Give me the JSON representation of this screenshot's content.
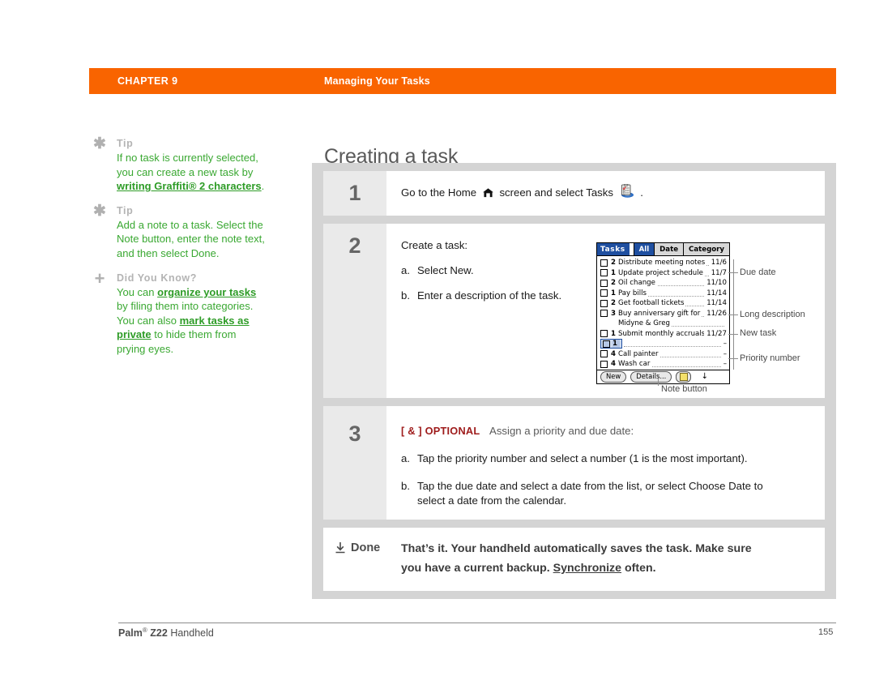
{
  "header": {
    "chapter_label": "CHAPTER 9",
    "chapter_title": "Managing Your Tasks",
    "accent_color": "#f96400"
  },
  "page_title": "Creating a task",
  "sidebar": {
    "blocks": [
      {
        "icon": "asterisk-icon",
        "heading": "Tip",
        "text_parts": [
          {
            "type": "text",
            "value": "If no task is currently selected, you can create a new task by "
          },
          {
            "type": "link",
            "value": "writing Graffiti® 2 characters"
          },
          {
            "type": "text",
            "value": "."
          }
        ]
      },
      {
        "icon": "asterisk-icon",
        "heading": "Tip",
        "text_parts": [
          {
            "type": "text",
            "value": "Add a note to a task. Select the Note button, enter the note text, and then select Done."
          }
        ]
      },
      {
        "icon": "plus-icon",
        "heading": "Did You Know?",
        "text_parts": [
          {
            "type": "text",
            "value": "You can "
          },
          {
            "type": "link",
            "value": "organize your tasks"
          },
          {
            "type": "text",
            "value": " by filing them into categories. You can also "
          },
          {
            "type": "link",
            "value": "mark tasks as private"
          },
          {
            "type": "text",
            "value": " to hide them from prying eyes."
          }
        ]
      }
    ]
  },
  "steps": {
    "step1": {
      "number": "1",
      "text_a": "Go to the Home",
      "text_b": "screen and select Tasks",
      "text_c": "."
    },
    "step2": {
      "number": "2",
      "intro": "Create a task:",
      "sub_a_marker": "a.",
      "sub_a": "Select New.",
      "sub_b_marker": "b.",
      "sub_b": "Enter a description of the task."
    },
    "step3": {
      "number": "3",
      "optional_tag": "[ & ] OPTIONAL",
      "optional_desc": "Assign a priority and due date:",
      "sub_a_marker": "a.",
      "sub_a": "Tap the priority number and select a number (1 is the most important).",
      "sub_b_marker": "b.",
      "sub_b_line1": "Tap the due date and select a date from the list, or select Choose Date to",
      "sub_b_line2": "select a date from the calendar."
    },
    "done": {
      "label": "Done",
      "line1": "That’s it. Your handheld automatically saves the task. Make sure",
      "line2_pre": "you have a current backup. ",
      "line2_link": "Synchronize",
      "line2_post": " often."
    }
  },
  "device": {
    "title": "Tasks",
    "tabs": [
      "All",
      "Date",
      "Category"
    ],
    "active_tab": "All",
    "rows": [
      {
        "priority": "2",
        "desc": "Distribute meeting notes",
        "due": "11/6",
        "selected": false,
        "continuation": false
      },
      {
        "priority": "1",
        "desc": "Update project schedule",
        "due": "11/7",
        "selected": false,
        "continuation": false
      },
      {
        "priority": "2",
        "desc": "Oil change",
        "due": "11/10",
        "selected": false,
        "continuation": false
      },
      {
        "priority": "1",
        "desc": "Pay bills",
        "due": "11/14",
        "selected": false,
        "continuation": false
      },
      {
        "priority": "2",
        "desc": "Get football tickets",
        "due": "11/14",
        "selected": false,
        "continuation": false
      },
      {
        "priority": "3",
        "desc": "Buy anniversary gift for",
        "due": "11/26",
        "selected": false,
        "continuation": false
      },
      {
        "priority": "",
        "desc": "Midyne & Greg",
        "due": "",
        "selected": false,
        "continuation": true
      },
      {
        "priority": "1",
        "desc": "Submit monthly accruals",
        "due": "11/27",
        "selected": false,
        "continuation": false
      },
      {
        "priority": "1",
        "desc": "",
        "due": "–",
        "selected": true,
        "continuation": false
      },
      {
        "priority": "4",
        "desc": "Call painter",
        "due": "–",
        "selected": false,
        "continuation": false
      },
      {
        "priority": "4",
        "desc": "Wash car",
        "due": "–",
        "selected": false,
        "continuation": false
      }
    ],
    "buttons": {
      "new": "New",
      "details": "Details...",
      "note_icon": "note-button-icon",
      "scroll_marker": "↓"
    }
  },
  "callouts": {
    "due_date": "Due date",
    "long_description": "Long description",
    "new_task": "New task",
    "priority_number": "Priority number",
    "note_button": "Note button"
  },
  "footer": {
    "brand": "Palm",
    "registered": "®",
    "model": "Z22",
    "product": "Handheld",
    "page_number": "155"
  }
}
